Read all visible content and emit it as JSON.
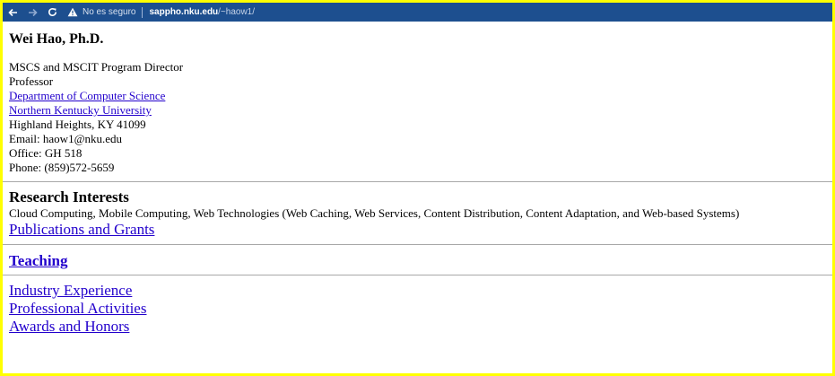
{
  "browser": {
    "security_text": "No es seguro",
    "url_host": "sappho.nku.edu",
    "url_path": "/~haow1/"
  },
  "profile": {
    "name": "Wei Hao, Ph.D.",
    "title1": "MSCS and MSCIT Program Director",
    "title2": "Professor",
    "dept_link": "Department of Computer Science",
    "univ_link": "Northern Kentucky University",
    "city": "Highland Heights, KY 41099",
    "email": "Email: haow1@nku.edu",
    "office": "Office: GH 518",
    "phone": "Phone: (859)572-5659"
  },
  "research": {
    "heading": "Research Interests",
    "text": "Cloud Computing, Mobile Computing, Web Technologies (Web Caching, Web Services, Content Distribution, Content Adaptation, and Web-based Systems)",
    "publications_link": "Publications and Grants"
  },
  "teaching": {
    "link": "Teaching"
  },
  "more": {
    "industry_link": "Industry Experience",
    "professional_link": "Professional Activities",
    "awards_link": "Awards and Honors"
  },
  "colors": {
    "highlight_border": "#ffff00",
    "browser_bar": "#1d4f8f",
    "link": "#2200cc"
  }
}
